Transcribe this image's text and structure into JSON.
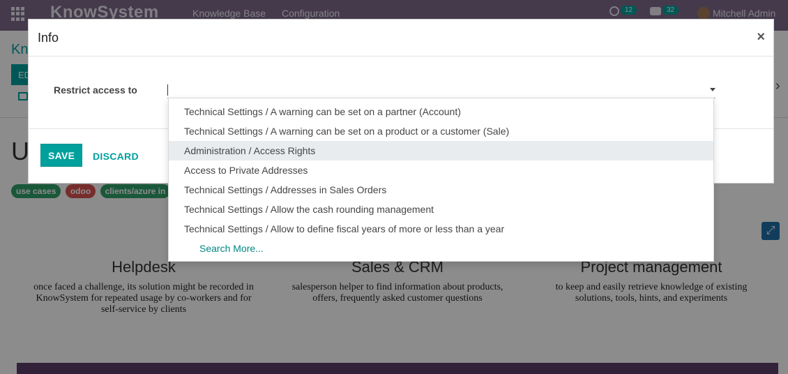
{
  "navbar": {
    "brand": "KnowSystem",
    "menu": [
      "Knowledge Base",
      "Configuration"
    ],
    "activities_count": "12",
    "messages_count": "32",
    "user_name": "Mitchell Admin"
  },
  "background": {
    "breadcrumb": "Kn",
    "edit_label": "ED",
    "title": "U",
    "tags": [
      {
        "label": "use cases",
        "color": "#30a06a"
      },
      {
        "label": "odoo",
        "color": "#d9534f"
      },
      {
        "label": "clients/azure in",
        "color": "#30a06a"
      }
    ],
    "features": [
      {
        "title": "Helpdesk",
        "text": "once faced a challenge, its solution might be recorded in KnowSystem for repeated usage by co-workers and for self-service by clients"
      },
      {
        "title": "Sales & CRM",
        "text": "salesperson helper to find information about products, offers, frequently asked customer questions"
      },
      {
        "title": "Project management",
        "text": "to keep and easily retrieve knowledge of existing solutions, tools, hints, and experiments"
      }
    ]
  },
  "modal": {
    "title": "Info",
    "close_label": "×",
    "field_label": "Restrict access to",
    "save_label": "SAVE",
    "discard_label": "DISCARD"
  },
  "dropdown": {
    "items": [
      "Technical Settings / A warning can be set on a partner (Account)",
      "Technical Settings / A warning can be set on a product or a customer (Sale)",
      "Administration / Access Rights",
      "Access to Private Addresses",
      "Technical Settings / Addresses in Sales Orders",
      "Technical Settings / Allow the cash rounding management",
      "Technical Settings / Allow to define fiscal years of more or less than a year"
    ],
    "active_index": 2,
    "search_more": "Search More..."
  },
  "colors": {
    "navbar": "#7c6a8a",
    "accent": "#00a09d"
  }
}
